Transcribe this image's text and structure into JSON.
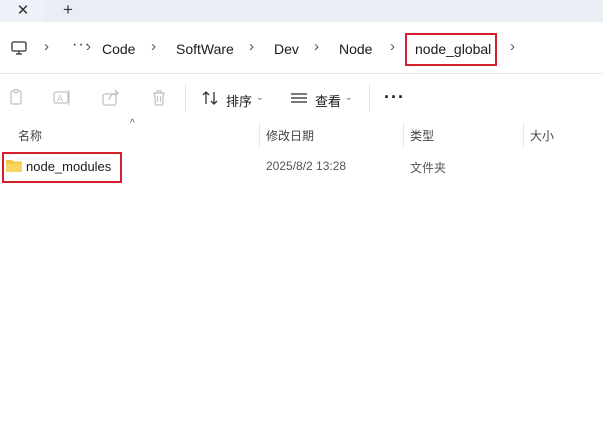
{
  "tabstrip": {
    "close_glyph": "✕",
    "add_glyph": "+"
  },
  "breadcrumb": {
    "more_glyph": "···",
    "items": [
      "Code",
      "SoftWare",
      "Dev",
      "Node",
      "node_global"
    ],
    "separator": "›"
  },
  "toolbar": {
    "sort_label": "排序",
    "view_label": "查看",
    "more_glyph": "···"
  },
  "columns": {
    "name": "名称",
    "modified": "修改日期",
    "type": "类型",
    "size": "大小"
  },
  "files": [
    {
      "name": "node_modules",
      "modified": "2025/8/2 13:28",
      "type": "文件夹",
      "size": ""
    }
  ],
  "colors": {
    "highlight": "#d4202a",
    "folder": "#f5c542"
  },
  "icons": [
    "close-icon",
    "add-icon",
    "computer-icon",
    "copy-icon",
    "rename-icon",
    "share-icon",
    "delete-icon",
    "sort-icon",
    "view-icon",
    "folder-icon"
  ]
}
